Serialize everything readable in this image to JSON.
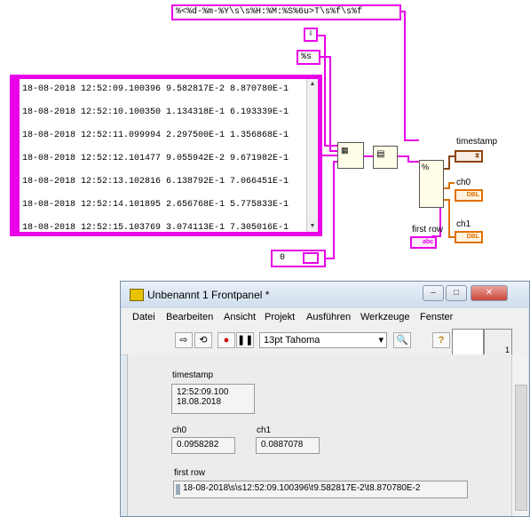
{
  "diagram": {
    "format_string": "%<%d-%m-%Y\\s\\s%H:%M:%S%6u>T\\s%f\\s%f",
    "delimiter_const": "%s",
    "offset_const": "0",
    "array_rows": [
      "18-08-2018  12:52:09.100396 9.582817E-2 8.870780E-1",
      "18-08-2018  12:52:10.100350 1.134318E-1 6.193339E-1",
      "18-08-2018  12:52:11.099994 2.297500E-1 1.356868E-1",
      "18-08-2018  12:52:12.101477 9.055942E-2 9.671982E-1",
      "18-08-2018  12:52:13.102816 6.138792E-1 7.066451E-1",
      "18-08-2018  12:52:14.101895 2.656768E-1 5.775833E-1",
      "18-08-2018  12:52:15.103769 3.074113E-1 7.305016E-1"
    ],
    "labels": {
      "timestamp": "timestamp",
      "ch0": "ch0",
      "ch1": "ch1",
      "first_row": "first row"
    },
    "terminal_types": {
      "timestamp": "⧗",
      "ch0": "DBL",
      "ch1": "DBL",
      "first_row": "abc"
    }
  },
  "window": {
    "title": "Unbenannt 1 Frontpanel *",
    "menu": [
      "Datei",
      "Bearbeiten",
      "Ansicht",
      "Projekt",
      "Ausführen",
      "Werkzeuge",
      "Fenster"
    ],
    "font_select": "13pt Tahoma",
    "connector_number": "1"
  },
  "panel": {
    "timestamp_label": "timestamp",
    "timestamp_time": "12:52:09.100",
    "timestamp_date": "18.08.2018",
    "ch0_label": "ch0",
    "ch0_value": "0.0958282",
    "ch1_label": "ch1",
    "ch1_value": "0.0887078",
    "first_row_label": "first row",
    "first_row_value": "18-08-2018\\s\\s12:52:09.100396\\t9.582817E-2\\t8.870780E-2"
  },
  "colors": {
    "string_wire": "#e800e8",
    "dbl_wire": "#e07000",
    "timestamp_wire": "#8b4513"
  }
}
